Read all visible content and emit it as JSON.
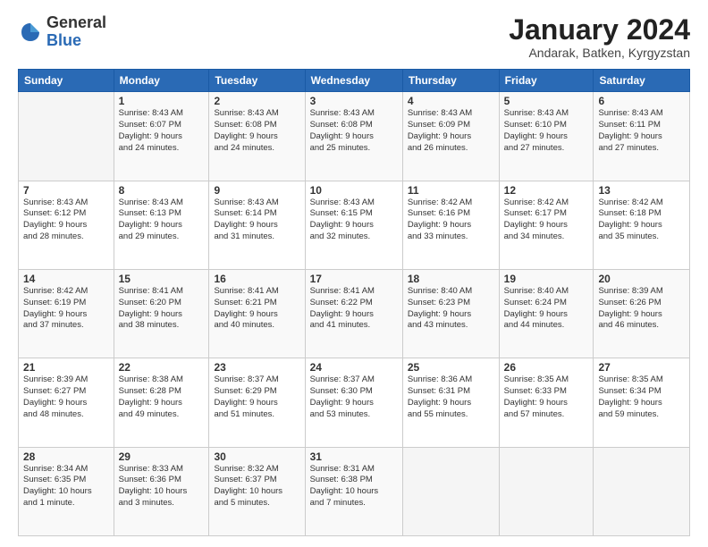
{
  "logo": {
    "general": "General",
    "blue": "Blue"
  },
  "title": "January 2024",
  "subtitle": "Andarak, Batken, Kyrgyzstan",
  "days_header": [
    "Sunday",
    "Monday",
    "Tuesday",
    "Wednesday",
    "Thursday",
    "Friday",
    "Saturday"
  ],
  "weeks": [
    [
      {
        "num": "",
        "info": ""
      },
      {
        "num": "1",
        "info": "Sunrise: 8:43 AM\nSunset: 6:07 PM\nDaylight: 9 hours\nand 24 minutes."
      },
      {
        "num": "2",
        "info": "Sunrise: 8:43 AM\nSunset: 6:08 PM\nDaylight: 9 hours\nand 24 minutes."
      },
      {
        "num": "3",
        "info": "Sunrise: 8:43 AM\nSunset: 6:08 PM\nDaylight: 9 hours\nand 25 minutes."
      },
      {
        "num": "4",
        "info": "Sunrise: 8:43 AM\nSunset: 6:09 PM\nDaylight: 9 hours\nand 26 minutes."
      },
      {
        "num": "5",
        "info": "Sunrise: 8:43 AM\nSunset: 6:10 PM\nDaylight: 9 hours\nand 27 minutes."
      },
      {
        "num": "6",
        "info": "Sunrise: 8:43 AM\nSunset: 6:11 PM\nDaylight: 9 hours\nand 27 minutes."
      }
    ],
    [
      {
        "num": "7",
        "info": "Sunrise: 8:43 AM\nSunset: 6:12 PM\nDaylight: 9 hours\nand 28 minutes."
      },
      {
        "num": "8",
        "info": "Sunrise: 8:43 AM\nSunset: 6:13 PM\nDaylight: 9 hours\nand 29 minutes."
      },
      {
        "num": "9",
        "info": "Sunrise: 8:43 AM\nSunset: 6:14 PM\nDaylight: 9 hours\nand 31 minutes."
      },
      {
        "num": "10",
        "info": "Sunrise: 8:43 AM\nSunset: 6:15 PM\nDaylight: 9 hours\nand 32 minutes."
      },
      {
        "num": "11",
        "info": "Sunrise: 8:42 AM\nSunset: 6:16 PM\nDaylight: 9 hours\nand 33 minutes."
      },
      {
        "num": "12",
        "info": "Sunrise: 8:42 AM\nSunset: 6:17 PM\nDaylight: 9 hours\nand 34 minutes."
      },
      {
        "num": "13",
        "info": "Sunrise: 8:42 AM\nSunset: 6:18 PM\nDaylight: 9 hours\nand 35 minutes."
      }
    ],
    [
      {
        "num": "14",
        "info": "Sunrise: 8:42 AM\nSunset: 6:19 PM\nDaylight: 9 hours\nand 37 minutes."
      },
      {
        "num": "15",
        "info": "Sunrise: 8:41 AM\nSunset: 6:20 PM\nDaylight: 9 hours\nand 38 minutes."
      },
      {
        "num": "16",
        "info": "Sunrise: 8:41 AM\nSunset: 6:21 PM\nDaylight: 9 hours\nand 40 minutes."
      },
      {
        "num": "17",
        "info": "Sunrise: 8:41 AM\nSunset: 6:22 PM\nDaylight: 9 hours\nand 41 minutes."
      },
      {
        "num": "18",
        "info": "Sunrise: 8:40 AM\nSunset: 6:23 PM\nDaylight: 9 hours\nand 43 minutes."
      },
      {
        "num": "19",
        "info": "Sunrise: 8:40 AM\nSunset: 6:24 PM\nDaylight: 9 hours\nand 44 minutes."
      },
      {
        "num": "20",
        "info": "Sunrise: 8:39 AM\nSunset: 6:26 PM\nDaylight: 9 hours\nand 46 minutes."
      }
    ],
    [
      {
        "num": "21",
        "info": "Sunrise: 8:39 AM\nSunset: 6:27 PM\nDaylight: 9 hours\nand 48 minutes."
      },
      {
        "num": "22",
        "info": "Sunrise: 8:38 AM\nSunset: 6:28 PM\nDaylight: 9 hours\nand 49 minutes."
      },
      {
        "num": "23",
        "info": "Sunrise: 8:37 AM\nSunset: 6:29 PM\nDaylight: 9 hours\nand 51 minutes."
      },
      {
        "num": "24",
        "info": "Sunrise: 8:37 AM\nSunset: 6:30 PM\nDaylight: 9 hours\nand 53 minutes."
      },
      {
        "num": "25",
        "info": "Sunrise: 8:36 AM\nSunset: 6:31 PM\nDaylight: 9 hours\nand 55 minutes."
      },
      {
        "num": "26",
        "info": "Sunrise: 8:35 AM\nSunset: 6:33 PM\nDaylight: 9 hours\nand 57 minutes."
      },
      {
        "num": "27",
        "info": "Sunrise: 8:35 AM\nSunset: 6:34 PM\nDaylight: 9 hours\nand 59 minutes."
      }
    ],
    [
      {
        "num": "28",
        "info": "Sunrise: 8:34 AM\nSunset: 6:35 PM\nDaylight: 10 hours\nand 1 minute."
      },
      {
        "num": "29",
        "info": "Sunrise: 8:33 AM\nSunset: 6:36 PM\nDaylight: 10 hours\nand 3 minutes."
      },
      {
        "num": "30",
        "info": "Sunrise: 8:32 AM\nSunset: 6:37 PM\nDaylight: 10 hours\nand 5 minutes."
      },
      {
        "num": "31",
        "info": "Sunrise: 8:31 AM\nSunset: 6:38 PM\nDaylight: 10 hours\nand 7 minutes."
      },
      {
        "num": "",
        "info": ""
      },
      {
        "num": "",
        "info": ""
      },
      {
        "num": "",
        "info": ""
      }
    ]
  ]
}
